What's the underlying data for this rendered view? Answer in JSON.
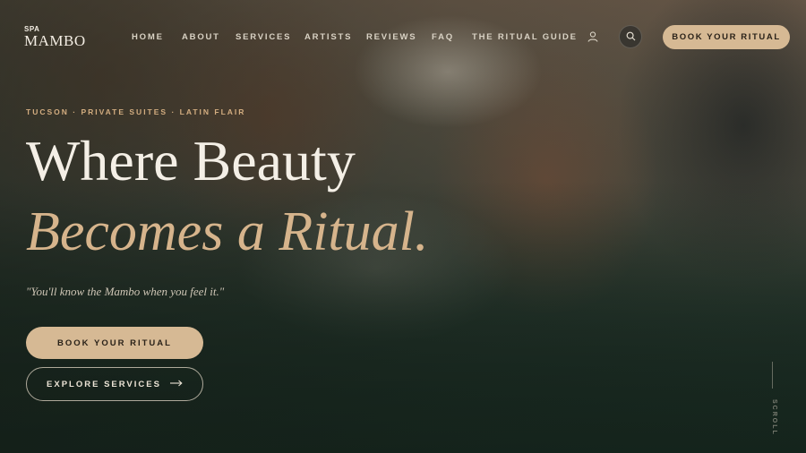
{
  "brand": {
    "small": "SPA",
    "name": "MAMBO"
  },
  "nav": {
    "items": [
      {
        "label": "HOME"
      },
      {
        "label": "ABOUT"
      },
      {
        "label": "SERVICES"
      },
      {
        "label": "ARTISTS"
      },
      {
        "label": "REVIEWS"
      },
      {
        "label": "FAQ"
      },
      {
        "label": "THE RITUAL GUIDE"
      }
    ],
    "account_icon": "user-icon",
    "search_icon": "search-icon",
    "cta_label": "BOOK YOUR RITUAL"
  },
  "hero": {
    "eyebrow": "TUCSON · PRIVATE SUITES · LATIN FLAIR",
    "headline_line1": "Where Beauty",
    "headline_line2": "Becomes a Ritual.",
    "tagline": "\"You'll know the Mambo when you feel it.\"",
    "primary_cta": "BOOK YOUR RITUAL",
    "secondary_cta": "EXPLORE SERVICES",
    "secondary_cta_icon": "arrow-right-icon",
    "scroll_label": "SCROLL"
  },
  "colors": {
    "accent": "#d6b994",
    "headline": "#f4efe6",
    "headline_accent": "#d6b48c",
    "background": "#1b2a22"
  }
}
